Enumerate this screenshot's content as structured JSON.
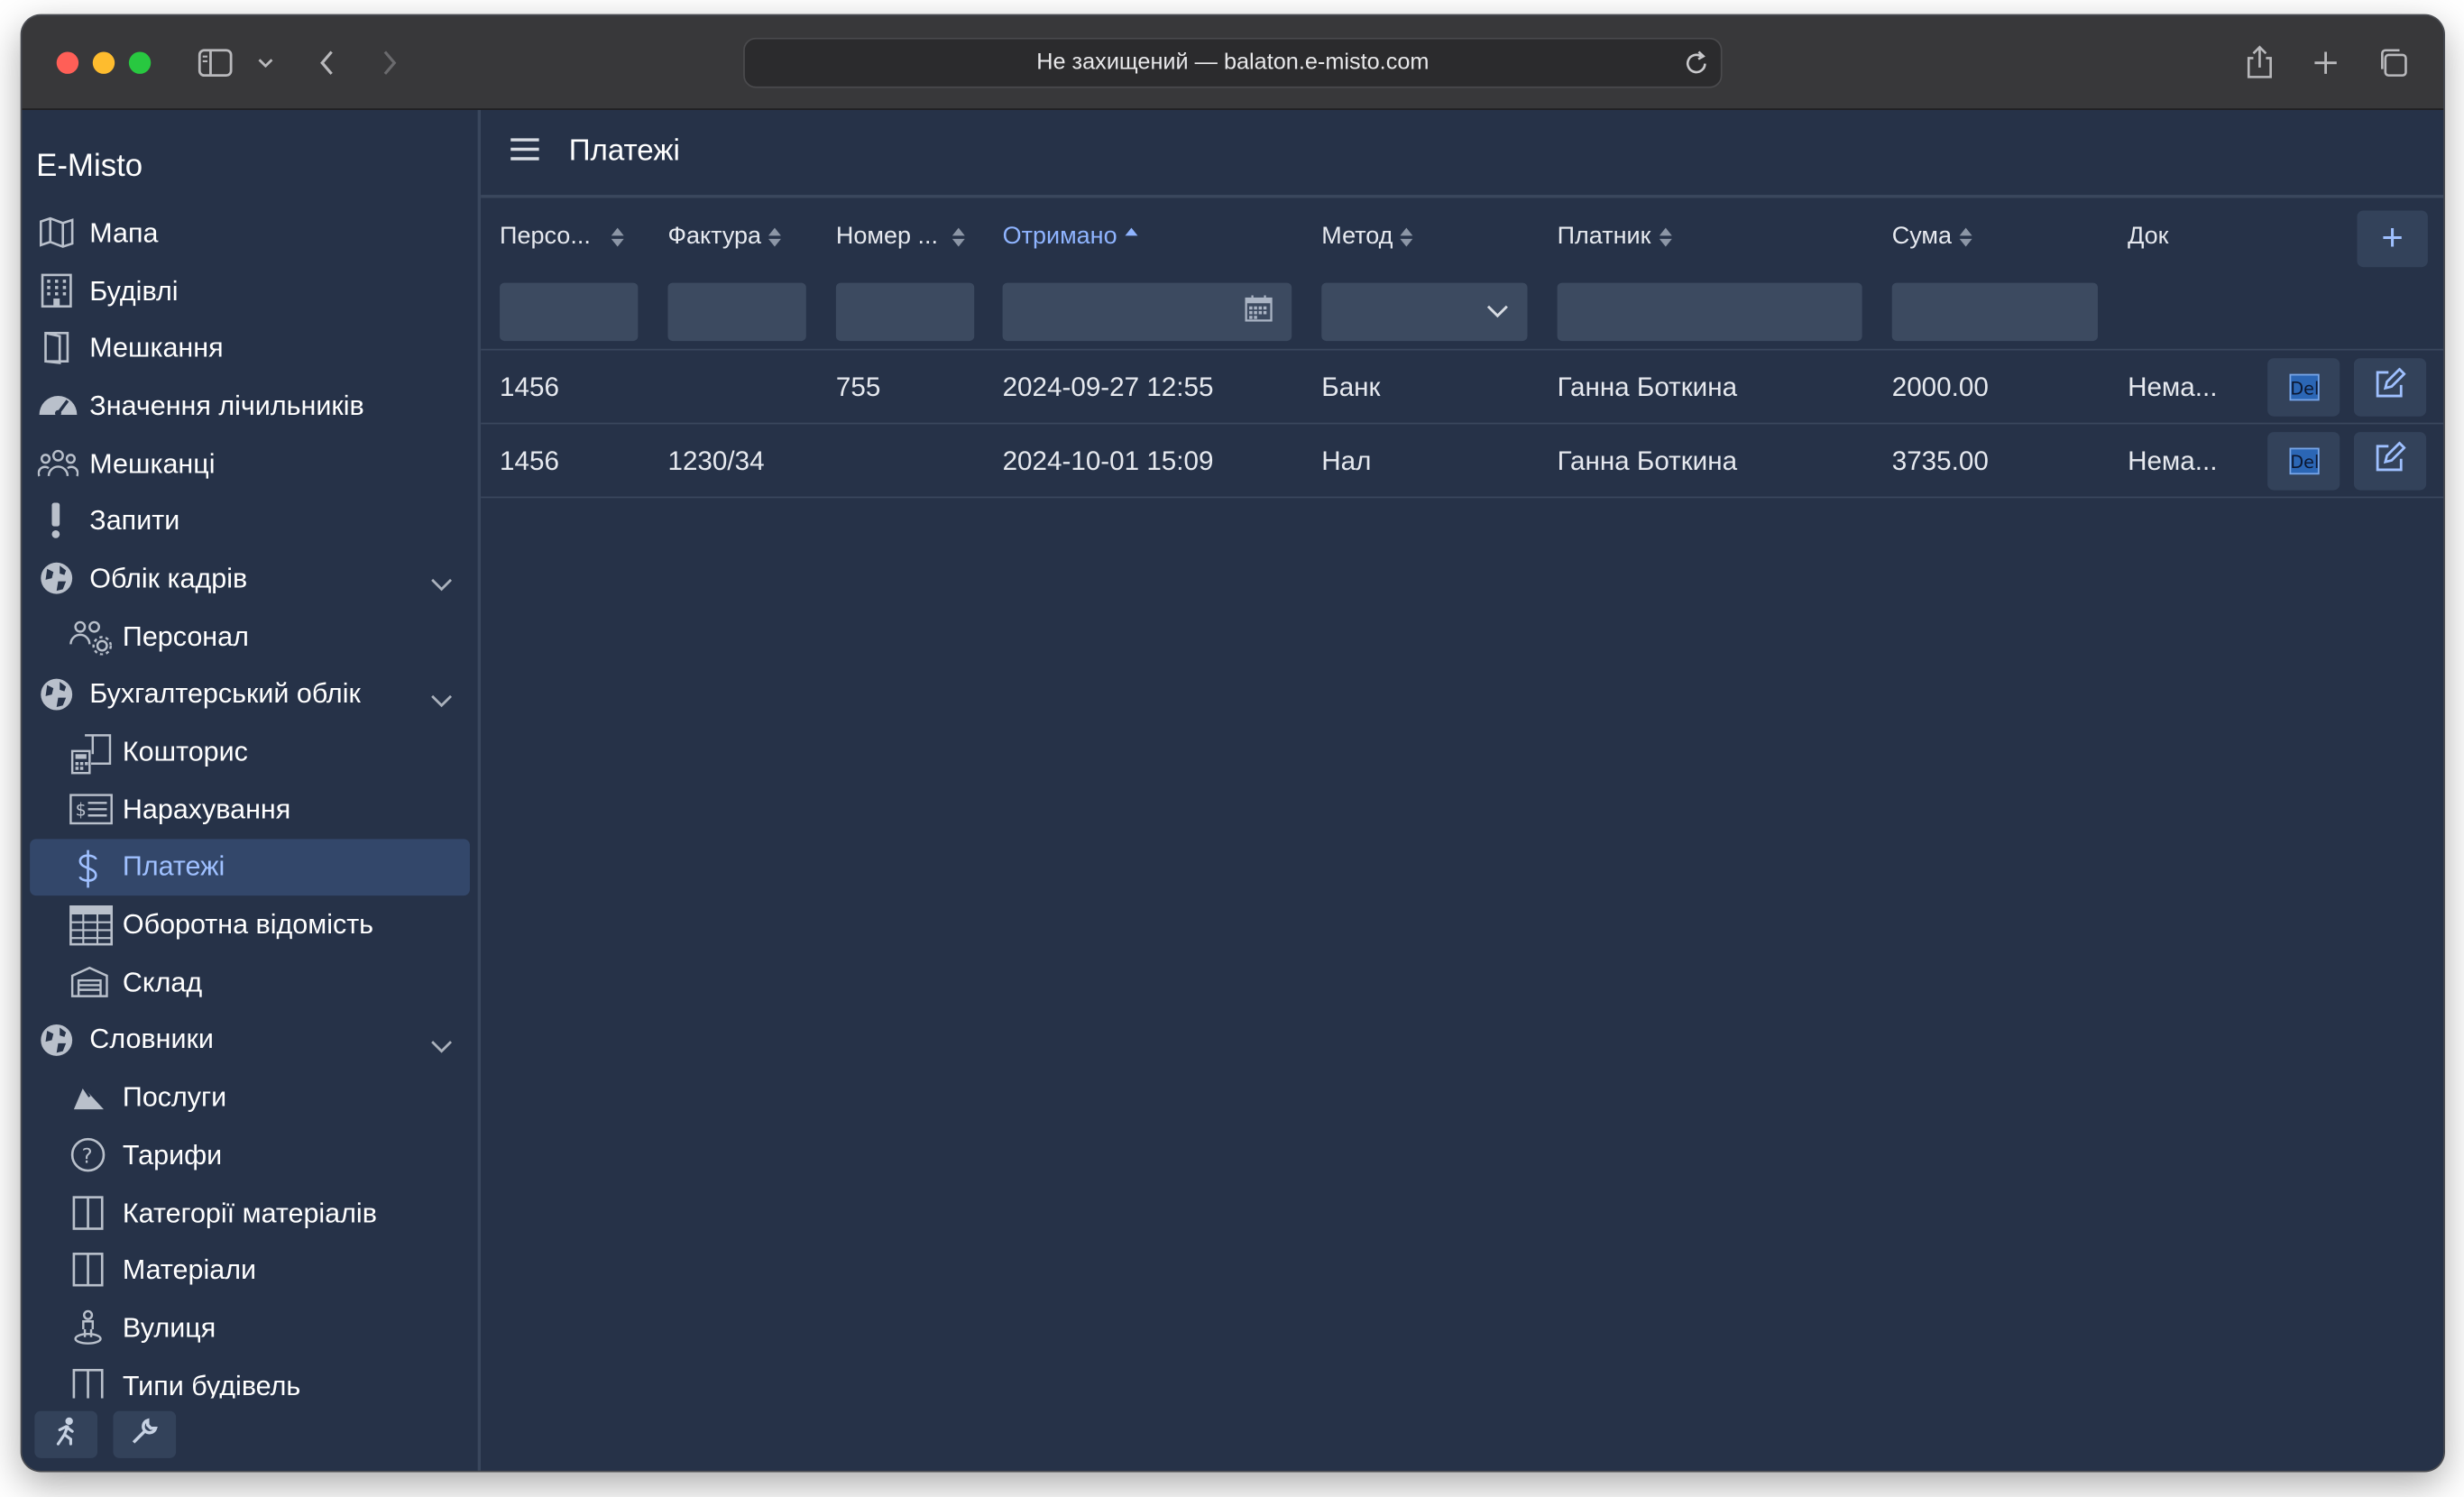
{
  "browser": {
    "address": "Не захищений — balaton.e-misto.com"
  },
  "app": {
    "brand": "E-Misto",
    "page_title": "Платежі"
  },
  "sidebar": {
    "items": [
      {
        "label": "Мапа",
        "icon": "map-icon",
        "level": 0
      },
      {
        "label": "Будівлі",
        "icon": "building-icon",
        "level": 0
      },
      {
        "label": "Мешкання",
        "icon": "door-icon",
        "level": 0
      },
      {
        "label": "Значення лічильників",
        "icon": "gauge-icon",
        "level": 0
      },
      {
        "label": "Мешканці",
        "icon": "people-icon",
        "level": 0
      },
      {
        "label": "Запити",
        "icon": "exclamation-icon",
        "level": 0
      },
      {
        "label": "Облік кадрів",
        "icon": "globe-icon",
        "level": 0,
        "expanded": true
      },
      {
        "label": "Персонал",
        "icon": "people-gear-icon",
        "level": 1
      },
      {
        "label": "Бухгалтерський облік",
        "icon": "globe-icon",
        "level": 0,
        "expanded": true
      },
      {
        "label": "Кошторис",
        "icon": "calculator-book-icon",
        "level": 1
      },
      {
        "label": "Нарахування",
        "icon": "invoice-icon",
        "level": 1
      },
      {
        "label": "Платежі",
        "icon": "dollar-icon",
        "level": 1,
        "active": true
      },
      {
        "label": "Оборотна відомість",
        "icon": "table-icon",
        "level": 1
      },
      {
        "label": "Склад",
        "icon": "warehouse-icon",
        "level": 1
      },
      {
        "label": "Словники",
        "icon": "globe-icon",
        "level": 0,
        "expanded": true
      },
      {
        "label": "Послуги",
        "icon": "hand-service-icon",
        "level": 1
      },
      {
        "label": "Тарифи",
        "icon": "question-circle-icon",
        "level": 1
      },
      {
        "label": "Категорії матеріалів",
        "icon": "panel-icon",
        "level": 1
      },
      {
        "label": "Матеріали",
        "icon": "panel-icon",
        "level": 1
      },
      {
        "label": "Вулиця",
        "icon": "location-person-icon",
        "level": 1
      },
      {
        "label": "Типи будівель",
        "icon": "panel-icon",
        "level": 1
      }
    ],
    "bottom_buttons": [
      "run-icon",
      "wrench-icon"
    ]
  },
  "table": {
    "columns": [
      {
        "label": "Персо...",
        "sort": "none"
      },
      {
        "label": "Фактура",
        "sort": "none"
      },
      {
        "label": "Номер ...",
        "sort": "none"
      },
      {
        "label": "Отримано",
        "sort": "asc"
      },
      {
        "label": "Метод",
        "sort": "none"
      },
      {
        "label": "Платник",
        "sort": "none"
      },
      {
        "label": "Сума",
        "sort": "none"
      },
      {
        "label": "Док",
        "sort": "none"
      }
    ],
    "rows": [
      {
        "person": "1456",
        "invoice": "",
        "number": "755",
        "received": "2024-09-27 12:55",
        "method": "Банк",
        "payer": "Ганна Боткина",
        "amount": "2000.00",
        "doc": "Нема...",
        "del_label": "Del"
      },
      {
        "person": "1456",
        "invoice": "1230/34",
        "number": "",
        "received": "2024-10-01 15:09",
        "method": "Нал",
        "payer": "Ганна Боткина",
        "amount": "3735.00",
        "doc": "Нема...",
        "del_label": "Del"
      }
    ],
    "add_label": "+"
  },
  "colors": {
    "background": "#263248",
    "accent": "#8fb4ff",
    "active_item_bg": "#33476a",
    "input_bg": "#3c4a60"
  }
}
